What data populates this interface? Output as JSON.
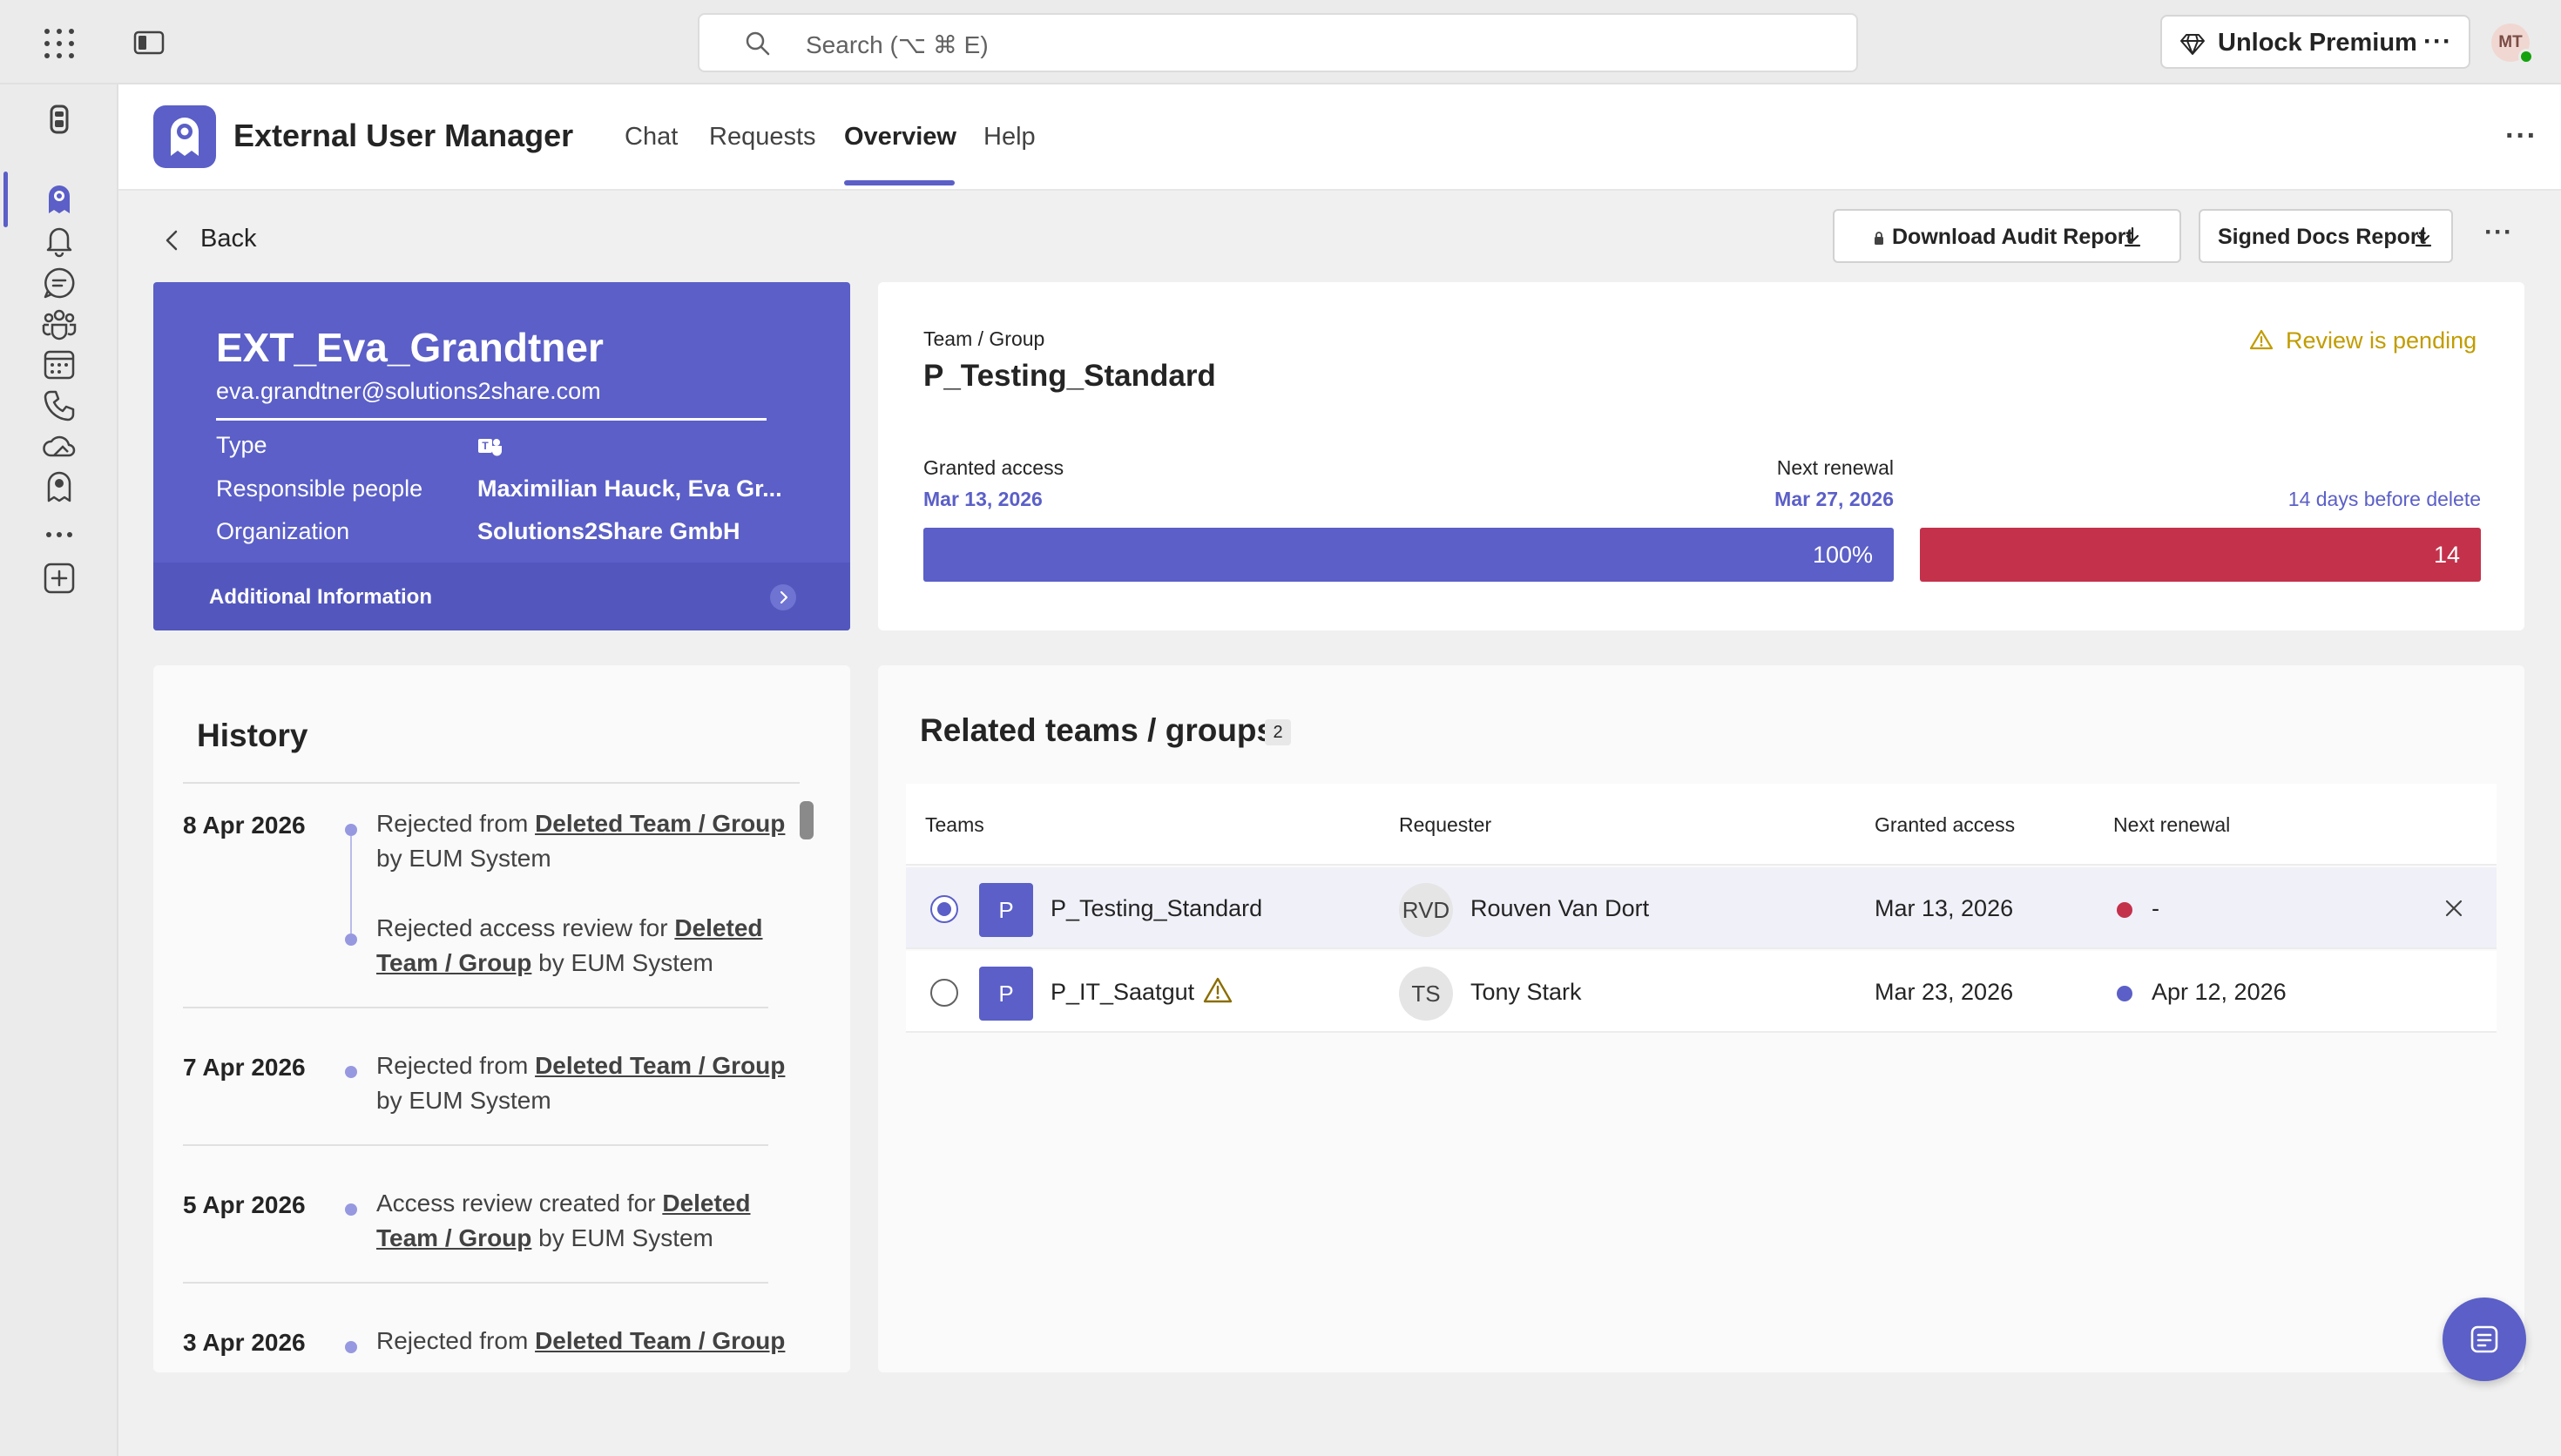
{
  "topbar": {
    "search_placeholder": "Search (⌥ ⌘ E)",
    "premium_label": "Unlock Premium",
    "premium_more": "···",
    "user_initials": "MT"
  },
  "app": {
    "title": "External User Manager",
    "tabs": [
      {
        "label": "Chat",
        "active": false
      },
      {
        "label": "Requests",
        "active": false
      },
      {
        "label": "Overview",
        "active": true
      },
      {
        "label": "Help",
        "active": false
      }
    ],
    "more": "···"
  },
  "toolbar": {
    "back_label": "Back",
    "download_audit_label": "Download Audit Report",
    "signed_docs_label": "Signed Docs Report",
    "more": "···"
  },
  "profile": {
    "name": "EXT_Eva_Grandtner",
    "email": "eva.grandtner@solutions2share.com",
    "type_label": "Type",
    "responsible_label": "Responsible people",
    "responsible_value": "Maximilian Hauck, Eva Gr...",
    "org_label": "Organization",
    "org_value": "Solutions2Share GmbH",
    "additional_label": "Additional Information"
  },
  "team": {
    "group_label": "Team / Group",
    "name": "P_Testing_Standard",
    "review_status": "Review is pending",
    "granted_label": "Granted access",
    "granted_date": "Mar 13, 2026",
    "renewal_label": "Next renewal",
    "renewal_date": "Mar 27, 2026",
    "delete_label": "14 days before delete",
    "progress_label": "100%",
    "progress_fraction": 1.0,
    "days_left": "14"
  },
  "history": {
    "title": "History",
    "entries": [
      {
        "date": "8 Apr 2026",
        "items": [
          {
            "pre": "Rejected from ",
            "link": "Deleted Team / Group",
            "post": " by EUM System"
          },
          {
            "pre": "Rejected access review for ",
            "link": "Deleted Team / Group",
            "post": " by EUM System"
          }
        ]
      },
      {
        "date": "7 Apr 2026",
        "items": [
          {
            "pre": "Rejected from ",
            "link": "Deleted Team / Group",
            "post": " by EUM System"
          }
        ]
      },
      {
        "date": "5 Apr 2026",
        "items": [
          {
            "pre": "Access review created for ",
            "link": "Deleted Team / Group",
            "post": " by EUM System"
          }
        ]
      },
      {
        "date": "3 Apr 2026",
        "items": [
          {
            "pre": "Rejected from ",
            "link": "Deleted Team / Group",
            "post": ""
          }
        ]
      }
    ]
  },
  "related": {
    "title": "Related teams / groups",
    "count": "2",
    "columns": [
      "Teams",
      "Requester",
      "Granted access",
      "Next renewal"
    ],
    "rows": [
      {
        "tile": "P",
        "team": "P_Testing_Standard",
        "warning": false,
        "initials": "RVD",
        "requester": "Rouven Van Dort",
        "granted": "Mar 13, 2026",
        "renewal": "-",
        "status_color": "#c4314b",
        "selected": true
      },
      {
        "tile": "P",
        "team": "P_IT_Saatgut",
        "warning": true,
        "initials": "TS",
        "requester": "Tony Stark",
        "granted": "Mar 23, 2026",
        "renewal": "Apr 12, 2026",
        "status_color": "#5b5fc7",
        "selected": false
      }
    ]
  },
  "colors": {
    "accent": "#5b5fc7",
    "danger": "#c4314b",
    "warning": "#c19c00"
  }
}
